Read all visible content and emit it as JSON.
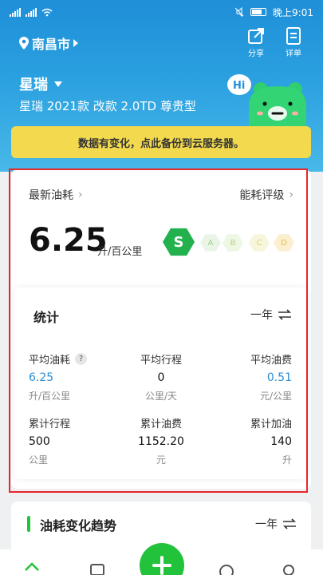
{
  "status_bar": {
    "time": "晚上9:01"
  },
  "topbar": {
    "city": "南昌市",
    "share_label": "分享",
    "detail_label": "详单"
  },
  "car": {
    "name": "星瑞",
    "model": "星瑞 2021款 改款 2.0TD 尊贵型"
  },
  "mascot": {
    "greeting": "Hi"
  },
  "banner": {
    "text": "数据有变化，点此备份到云服务器。"
  },
  "fuel": {
    "latest_label": "最新油耗",
    "rating_label": "能耗评级",
    "value": "6.25",
    "unit": "升/百公里",
    "grades": [
      "S",
      "A",
      "B",
      "C",
      "D"
    ],
    "current_grade": "S"
  },
  "stats": {
    "title": "统计",
    "period": "一年",
    "cells": [
      {
        "label": "平均油耗",
        "value": "6.25",
        "unit": "升/百公里",
        "help": "?"
      },
      {
        "label": "平均行程",
        "value": "0",
        "unit": "公里/天"
      },
      {
        "label": "平均油费",
        "value": "0.51",
        "unit": "元/公里"
      },
      {
        "label": "累计行程",
        "value": "500",
        "unit": "公里"
      },
      {
        "label": "累计油费",
        "value": "1152.20",
        "unit": "元"
      },
      {
        "label": "累计加油",
        "value": "140",
        "unit": "升"
      }
    ]
  },
  "trend": {
    "title": "油耗变化趋势",
    "period": "一年"
  },
  "colors": {
    "header": "#1f8fd8",
    "accent_green": "#22c33a",
    "banner": "#f2d94e",
    "highlight_blue": "#2a8dd4",
    "frame_red": "#e8262a"
  }
}
